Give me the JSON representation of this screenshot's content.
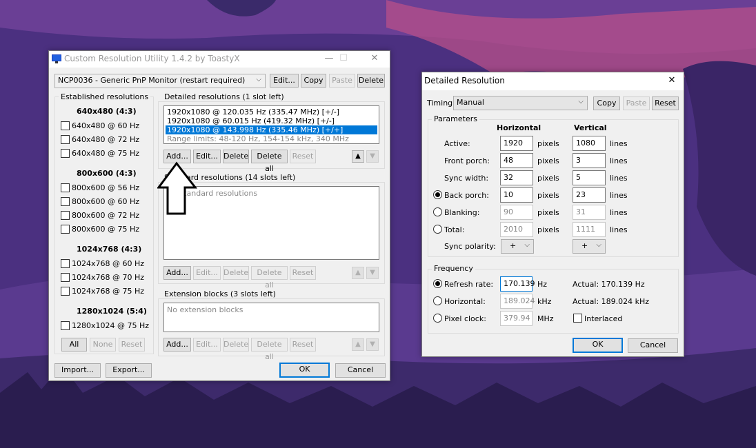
{
  "cru": {
    "title": "Custom Resolution Utility 1.4.2 by ToastyX",
    "monitor": "NCP0036 - Generic PnP Monitor (restart required)",
    "top_buttons": {
      "edit": "Edit...",
      "copy": "Copy",
      "paste": "Paste",
      "delete": "Delete"
    },
    "established": {
      "label": "Established resolutions",
      "groups": [
        {
          "heading": "640x480 (4:3)",
          "items": [
            "640x480 @ 60 Hz",
            "640x480 @ 72 Hz",
            "640x480 @ 75 Hz"
          ]
        },
        {
          "heading": "800x600 (4:3)",
          "items": [
            "800x600 @ 56 Hz",
            "800x600 @ 60 Hz",
            "800x600 @ 72 Hz",
            "800x600 @ 75 Hz"
          ]
        },
        {
          "heading": "1024x768 (4:3)",
          "items": [
            "1024x768 @ 60 Hz",
            "1024x768 @ 70 Hz",
            "1024x768 @ 75 Hz"
          ]
        },
        {
          "heading": "1280x1024 (5:4)",
          "items": [
            "1280x1024 @ 75 Hz"
          ]
        }
      ],
      "buttons": {
        "all": "All",
        "none": "None",
        "reset": "Reset"
      }
    },
    "detailed": {
      "label": "Detailed resolutions (1 slot left)",
      "items": [
        "1920x1080 @ 120.035 Hz (335.47 MHz) [+/-]",
        "1920x1080 @ 60.015 Hz (419.32 MHz) [+/-]",
        "1920x1080 @ 143.998 Hz (335.46 MHz) [+/+]"
      ],
      "range": "Range limits: 48-120 Hz, 154-154 kHz, 340 MHz"
    },
    "standard": {
      "label": "Standard resolutions (14 slots left)",
      "empty": "No standard resolutions"
    },
    "extension": {
      "label": "Extension blocks (3 slots left)",
      "empty": "No extension blocks"
    },
    "list_buttons": {
      "add": "Add...",
      "edit": "Edit...",
      "delete": "Delete",
      "delete_all": "Delete all",
      "reset": "Reset"
    },
    "bottom": {
      "import": "Import...",
      "export": "Export...",
      "ok": "OK",
      "cancel": "Cancel"
    }
  },
  "detail": {
    "title": "Detailed Resolution",
    "timing_label": "Timing:",
    "timing_value": "Manual",
    "buttons": {
      "copy": "Copy",
      "paste": "Paste",
      "reset": "Reset",
      "ok": "OK",
      "cancel": "Cancel"
    },
    "params_label": "Parameters",
    "horizontal": "Horizontal",
    "vertical": "Vertical",
    "rows": [
      {
        "label": "Active:",
        "h": "1920",
        "v": "1080"
      },
      {
        "label": "Front porch:",
        "h": "48",
        "v": "3"
      },
      {
        "label": "Sync width:",
        "h": "32",
        "v": "5"
      },
      {
        "label": "Back porch:",
        "h": "10",
        "v": "23"
      },
      {
        "label": "Blanking:",
        "h": "90",
        "v": "31"
      },
      {
        "label": "Total:",
        "h": "2010",
        "v": "1111"
      }
    ],
    "pixels": "pixels",
    "lines": "lines",
    "sync_polarity_label": "Sync polarity:",
    "sync_h": "+",
    "sync_v": "+",
    "freq_label": "Frequency",
    "refresh_label": "Refresh rate:",
    "refresh_value": "170.139",
    "refresh_unit": "Hz",
    "refresh_actual": "Actual: 170.139 Hz",
    "hfreq_label": "Horizontal:",
    "hfreq_value": "189.024",
    "hfreq_unit": "kHz",
    "hfreq_actual": "Actual: 189.024 kHz",
    "pclock_label": "Pixel clock:",
    "pclock_value": "379.94",
    "pclock_unit": "MHz",
    "interlaced": "Interlaced"
  }
}
